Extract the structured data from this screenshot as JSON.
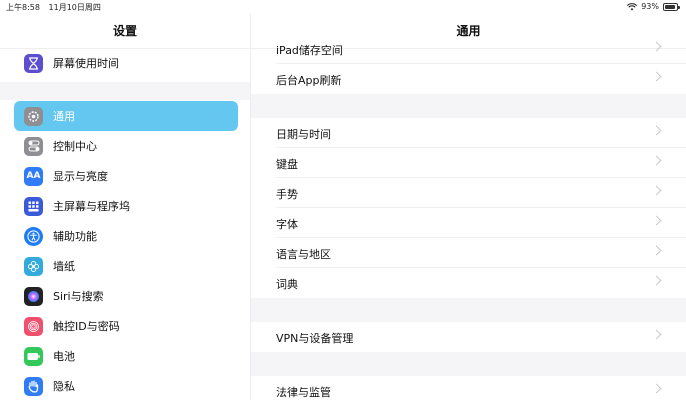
{
  "status_bar": {
    "time": "上午8:58",
    "date": "11月10日周四",
    "battery": "93%",
    "battery_level": 0.93
  },
  "sidebar": {
    "title": "设置",
    "items": [
      {
        "label": "屏幕使用时间",
        "icon": "hourglass-icon",
        "color": "#5b4fcf"
      },
      {
        "label": "通用",
        "icon": "gear-icon",
        "color": "#8e8e93",
        "selected": true
      },
      {
        "label": "控制中心",
        "icon": "toggles-icon",
        "color": "#8e8e93"
      },
      {
        "label": "显示与亮度",
        "icon": "text-size-icon",
        "color": "#2f7cf6",
        "glyph": "AA"
      },
      {
        "label": "主屏幕与程序坞",
        "icon": "grid-icon",
        "color": "#3a5ad9"
      },
      {
        "label": "辅助功能",
        "icon": "accessibility-icon",
        "color": "#1f7cf4"
      },
      {
        "label": "墙纸",
        "icon": "flower-icon",
        "color": "#34aadc"
      },
      {
        "label": "Siri与搜索",
        "icon": "siri-icon",
        "color": "#222222"
      },
      {
        "label": "触控ID与密码",
        "icon": "fingerprint-icon",
        "color": "#f0506e"
      },
      {
        "label": "电池",
        "icon": "battery-icon",
        "color": "#34c759"
      },
      {
        "label": "隐私",
        "icon": "hand-icon",
        "color": "#2f7cf6"
      }
    ]
  },
  "detail": {
    "title": "通用",
    "rows": [
      {
        "label": "iPad储存空间"
      },
      {
        "label": "后台App刷新"
      },
      {
        "label": "日期与时间"
      },
      {
        "label": "键盘"
      },
      {
        "label": "手势"
      },
      {
        "label": "字体"
      },
      {
        "label": "语言与地区"
      },
      {
        "label": "词典"
      },
      {
        "label": "VPN与设备管理"
      },
      {
        "label": "法律与监管"
      }
    ]
  }
}
